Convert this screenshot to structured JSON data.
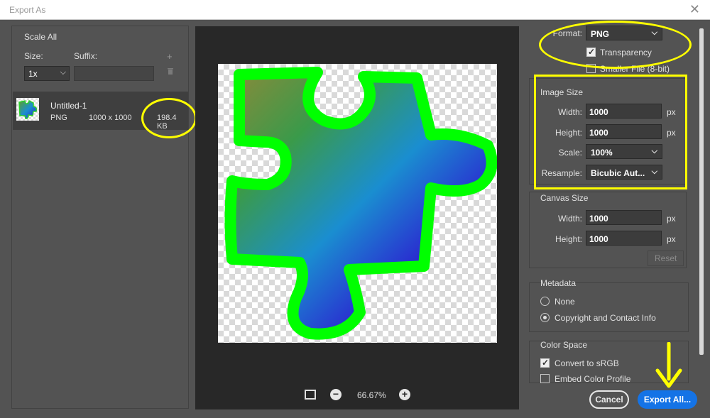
{
  "window": {
    "title": "Export As",
    "close_glyph": "✕"
  },
  "left": {
    "scale_all": "Scale All",
    "size_label": "Size:",
    "suffix_label": "Suffix:",
    "size_value": "1x",
    "suffix_value": "",
    "add_glyph": "+",
    "asset": {
      "name": "Untitled-1",
      "format": "PNG",
      "dimensions": "1000 x 1000",
      "file_size": "198.4 KB"
    }
  },
  "preview": {
    "zoom": "66.67%"
  },
  "settings": {
    "format_label": "Format:",
    "format_value": "PNG",
    "transparency_label": "Transparency",
    "smaller_file_label": "Smaller File (8-bit)",
    "image_size": {
      "title": "Image Size",
      "width_label": "Width:",
      "width_value": "1000",
      "height_label": "Height:",
      "height_value": "1000",
      "scale_label": "Scale:",
      "scale_value": "100%",
      "resample_label": "Resample:",
      "resample_value": "Bicubic Aut...",
      "unit": "px"
    },
    "canvas_size": {
      "title": "Canvas Size",
      "width_label": "Width:",
      "width_value": "1000",
      "height_label": "Height:",
      "height_value": "1000",
      "unit": "px",
      "reset_label": "Reset"
    },
    "metadata": {
      "title": "Metadata",
      "none_label": "None",
      "copyright_label": "Copyright and Contact Info"
    },
    "color_space": {
      "title": "Color Space",
      "convert_label": "Convert to sRGB",
      "embed_label": "Embed Color Profile"
    }
  },
  "footer": {
    "cancel_label": "Cancel",
    "export_label": "Export All..."
  },
  "colors": {
    "accent": "#1473e6",
    "highlight": "#ffff00",
    "puzzle_outline": "#00ff00"
  }
}
